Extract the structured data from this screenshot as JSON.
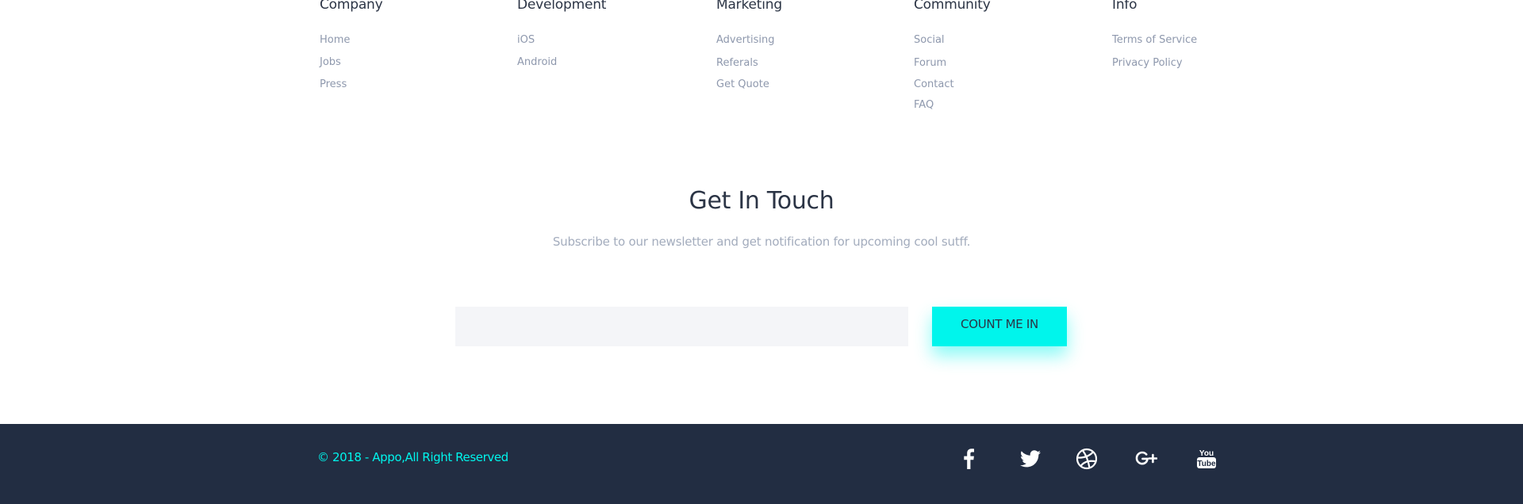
{
  "columns": [
    {
      "title": "Company",
      "links": [
        "Home",
        "Jobs",
        "Press"
      ]
    },
    {
      "title": "Development",
      "links": [
        "iOS",
        "Android"
      ]
    },
    {
      "title": "Marketing",
      "links": [
        "Advertising",
        "Referals",
        "Get Quote"
      ]
    },
    {
      "title": "Community",
      "links": [
        "Social",
        "Forum",
        "Contact",
        "FAQ"
      ]
    },
    {
      "title": "Info",
      "links": [
        "Terms of Service",
        "Privacy Policy"
      ]
    }
  ],
  "newsletter": {
    "title": "Get In Touch",
    "subtitle": "Subscribe to our newsletter and get notification for upcoming cool sutff.",
    "email_placeholder": "",
    "button_label": "Count me in"
  },
  "footer": {
    "copyright": "© 2018 - Appo,All Right Reserved",
    "social_icons": [
      "facebook-icon",
      "twitter-icon",
      "dribbble-icon",
      "google-plus-icon",
      "youtube-icon"
    ]
  },
  "colors": {
    "accent": "#00f5ec",
    "footer_background": "#222d42",
    "heading": "#2b3445",
    "link": "#8e98ad",
    "input_background": "#f4f5f8"
  }
}
